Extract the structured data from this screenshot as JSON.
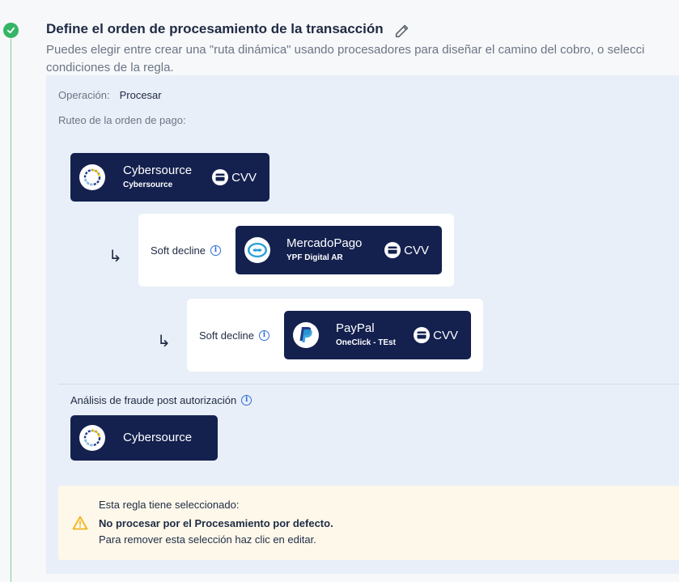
{
  "section": {
    "title": "Define el orden de procesamiento de la transacción",
    "description_line1": "Puedes elegir entre crear una \"ruta dinámica\" usando procesadores para diseñar el camino del cobro, o selecci",
    "description_line2": "condiciones de la regla."
  },
  "operation": {
    "label": "Operación:",
    "value": "Procesar"
  },
  "routing": {
    "label": "Ruteo de la orden de pago:",
    "primary": {
      "name": "Cybersource",
      "account": "Cybersource",
      "badge": "CVV",
      "logo_icon": "cybersource-logo-icon"
    },
    "fallbacks": [
      {
        "trigger": "Soft decline",
        "name": "MercadoPago",
        "account": "YPF Digital AR",
        "badge": "CVV",
        "logo_icon": "mercadopago-logo-icon"
      },
      {
        "trigger": "Soft decline",
        "name": "PayPal",
        "account": "OneClick - TEst",
        "badge": "CVV",
        "logo_icon": "paypal-logo-icon"
      }
    ]
  },
  "fraud": {
    "label": "Análisis de fraude post autorización",
    "processor": {
      "name": "Cybersource",
      "logo_icon": "cybersource-logo-icon"
    }
  },
  "notice": {
    "line1": "Esta regla tiene seleccionado:",
    "line2": "No procesar por el Procesamiento por defecto.",
    "line3": "Para remover esta selección haz clic en editar.",
    "icon": "warning-icon"
  },
  "colors": {
    "card_bg": "#14214f",
    "panel_bg": "#e9eff8",
    "success_green": "#35b566",
    "info_blue": "#2f6fd6",
    "warning_yellow": "#f2b21b",
    "notice_bg": "#fdf8ea"
  }
}
